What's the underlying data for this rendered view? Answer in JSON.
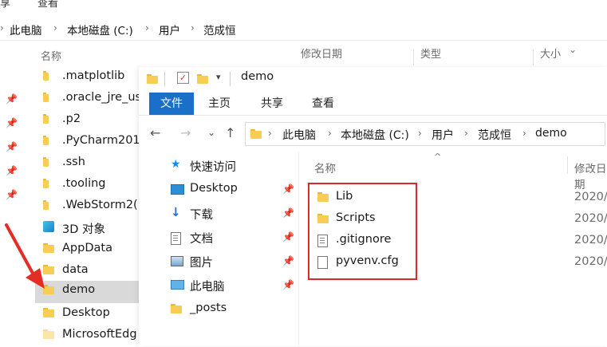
{
  "background_window": {
    "ribbon_fragments": [
      "享",
      "查看"
    ],
    "breadcrumb": [
      "此电脑",
      "本地磁盘 (C:)",
      "用户",
      "范成恒"
    ],
    "columns": [
      "名称",
      "修改日期",
      "类型",
      "大小"
    ],
    "items": [
      {
        "label": ".matplotlib",
        "pinned": false
      },
      {
        "label": ".oracle_jre_us",
        "pinned": true
      },
      {
        "label": ".p2",
        "pinned": true
      },
      {
        "label": ".PyCharm201",
        "pinned": true
      },
      {
        "label": ".ssh",
        "pinned": true
      },
      {
        "label": ".tooling",
        "pinned": true
      },
      {
        "label": ".WebStorm2(",
        "pinned": false
      },
      {
        "label": "3D 对象",
        "pinned": false
      },
      {
        "label": "AppData",
        "pinned": false
      },
      {
        "label": "data",
        "pinned": false
      },
      {
        "label": "demo",
        "pinned": false,
        "selected": true
      },
      {
        "label": "Desktop",
        "pinned": false
      },
      {
        "label": "MicrosoftEdg",
        "pinned": false
      }
    ]
  },
  "foreground_window": {
    "title": "demo",
    "ribbon_tabs": [
      "文件",
      "主页",
      "共享",
      "查看"
    ],
    "breadcrumb": [
      "此电脑",
      "本地磁盘 (C:)",
      "用户",
      "范成恒",
      "demo"
    ],
    "nav_tree": [
      {
        "label": "快速访问",
        "icon": "star-icon",
        "pinned": false
      },
      {
        "label": "Desktop",
        "icon": "desktop-icon",
        "pinned": true
      },
      {
        "label": "下载",
        "icon": "download-icon",
        "pinned": true
      },
      {
        "label": "文档",
        "icon": "document-icon",
        "pinned": true
      },
      {
        "label": "图片",
        "icon": "picture-icon",
        "pinned": true
      },
      {
        "label": "此电脑",
        "icon": "computer-icon",
        "pinned": true
      },
      {
        "label": "_posts",
        "icon": "folder-icon",
        "pinned": false
      }
    ],
    "list_headers": {
      "name": "名称",
      "date": "修改日期"
    },
    "files": [
      {
        "name": "Lib",
        "type": "folder",
        "date": "2020/"
      },
      {
        "name": "Scripts",
        "type": "folder",
        "date": "2020/"
      },
      {
        "name": ".gitignore",
        "type": "text",
        "date": "2020/"
      },
      {
        "name": "pyvenv.cfg",
        "type": "file",
        "date": "2020/"
      }
    ]
  },
  "colors": {
    "accent": "#1a6fc9",
    "highlight_box": "#e0262b",
    "selection": "#d9d9d9",
    "folder": "#f8cd56"
  }
}
